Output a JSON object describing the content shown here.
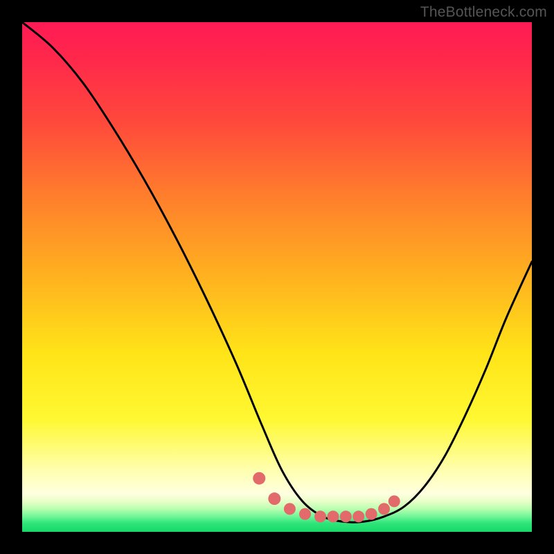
{
  "watermark": "TheBottleneck.com",
  "chart_data": {
    "type": "line",
    "title": "",
    "xlabel": "",
    "ylabel": "",
    "xlim": [
      0,
      100
    ],
    "ylim": [
      0,
      100
    ],
    "series": [
      {
        "name": "bottleneck-curve",
        "x": [
          0,
          6,
          12,
          18,
          24,
          30,
          36,
          42,
          47,
          51,
          55,
          59,
          63,
          67,
          71,
          75,
          79,
          83,
          87,
          91,
          95,
          100
        ],
        "y": [
          100,
          95,
          88,
          79,
          69,
          58,
          46,
          33,
          21,
          12,
          6,
          3,
          2,
          2,
          3,
          5,
          9,
          15,
          23,
          32,
          42,
          53
        ]
      }
    ],
    "note": "y is bottleneck percent (0 = green/bottom, 100 = red/top); curve dips to near-0 around x 60–68 and rises on both sides",
    "markers": {
      "color": "#e26a6a",
      "points_x": [
        46.5,
        49.5,
        52.5,
        55.5,
        58.5,
        61,
        63.5,
        66,
        68.5,
        71,
        73
      ],
      "points_y": [
        10.5,
        6.5,
        4.5,
        3.5,
        3.0,
        3.0,
        3.0,
        3.0,
        3.5,
        4.5,
        6.0
      ]
    },
    "background": {
      "type": "vertical-gradient",
      "stops": [
        {
          "pos": 0.0,
          "color": "#ff1a55"
        },
        {
          "pos": 0.5,
          "color": "#ffb21f"
        },
        {
          "pos": 0.8,
          "color": "#fff832"
        },
        {
          "pos": 0.93,
          "color": "#ffffe0"
        },
        {
          "pos": 1.0,
          "color": "#17d968"
        }
      ]
    }
  }
}
